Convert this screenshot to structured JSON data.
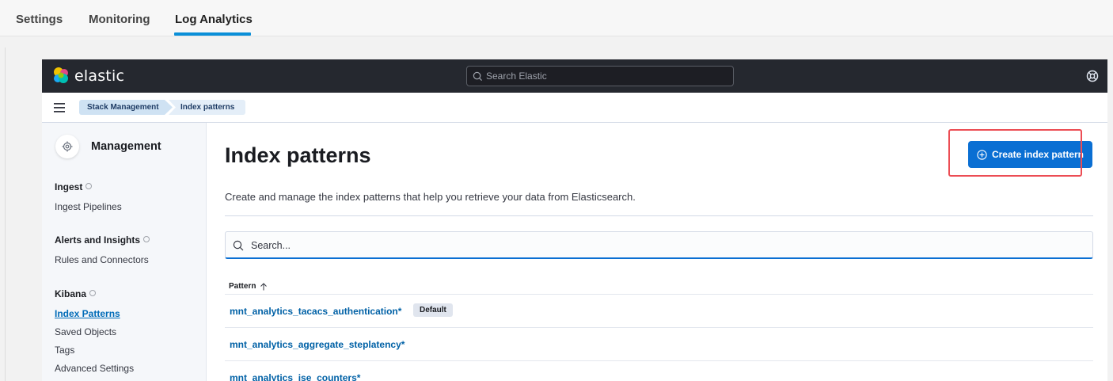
{
  "top_tabs": [
    {
      "label": "Settings"
    },
    {
      "label": "Monitoring"
    },
    {
      "label": "Log Analytics",
      "active": true
    }
  ],
  "header": {
    "logo_text": "elastic",
    "search_placeholder": "Search Elastic"
  },
  "breadcrumbs": [
    {
      "label": "Stack Management"
    },
    {
      "label": "Index patterns"
    }
  ],
  "sidebar": {
    "title": "Management",
    "sections": [
      {
        "heading": "Ingest",
        "items": [
          "Ingest Pipelines"
        ]
      },
      {
        "heading": "Alerts and Insights",
        "items": [
          "Rules and Connectors"
        ]
      },
      {
        "heading": "Kibana",
        "items": [
          "Index Patterns",
          "Saved Objects",
          "Tags",
          "Advanced Settings"
        ],
        "active_item": "Index Patterns"
      }
    ]
  },
  "main": {
    "title": "Index patterns",
    "subtitle": "Create and manage the index patterns that help you retrieve your data from Elasticsearch.",
    "create_button_label": "Create index pattern",
    "search_placeholder": "Search...",
    "table": {
      "column_header": "Pattern",
      "sort": "ascending",
      "rows": [
        {
          "pattern": "mnt_analytics_tacacs_authentication*",
          "badge": "Default"
        },
        {
          "pattern": "mnt_analytics_aggregate_steplatency*"
        },
        {
          "pattern": "mnt_analytics_ise_counters*"
        }
      ]
    }
  },
  "colors": {
    "header_bg": "#25282f",
    "primary_button": "#0a6fd3",
    "link": "#0061a6",
    "tab_underline": "#0a8fd8",
    "highlight_box": "#ec4d54"
  }
}
